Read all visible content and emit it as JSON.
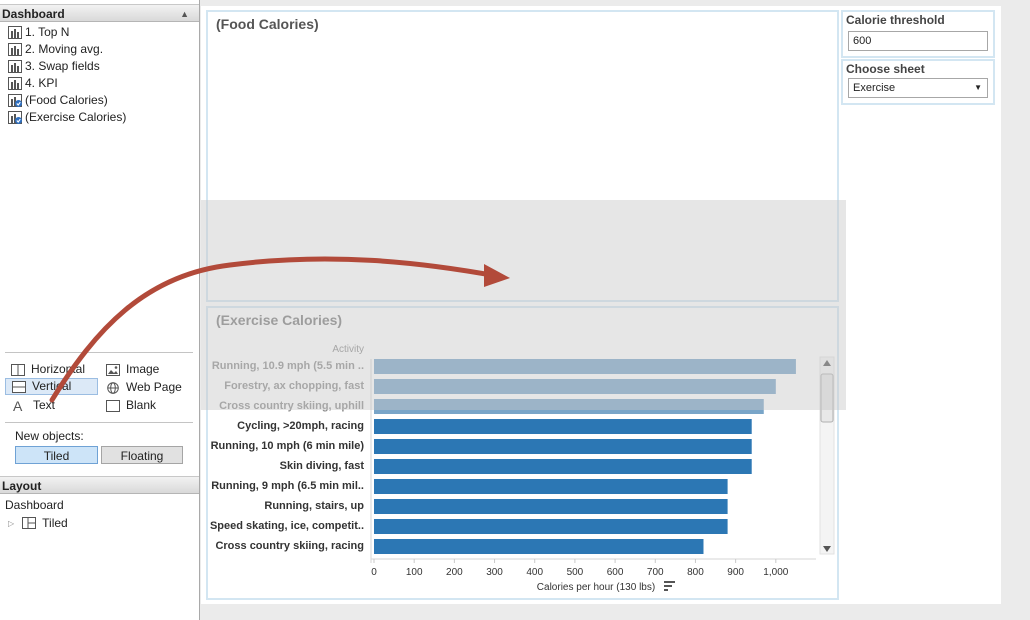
{
  "sidebar": {
    "dashboard_header": "Dashboard",
    "sheets": [
      {
        "label": "1. Top N",
        "icon": "bar-chart-icon"
      },
      {
        "label": "2. Moving avg.",
        "icon": "bar-chart-icon"
      },
      {
        "label": "3. Swap fields",
        "icon": "bar-chart-icon"
      },
      {
        "label": "4. KPI",
        "icon": "bar-chart-icon"
      },
      {
        "label": "(Food Calories)",
        "icon": "bar-chart-check-icon"
      },
      {
        "label": "(Exercise Calories)",
        "icon": "bar-chart-check-icon"
      }
    ],
    "objects": {
      "horizontal": "Horizontal",
      "vertical": "Vertical",
      "text": "Text",
      "image": "Image",
      "web_page": "Web Page",
      "blank": "Blank"
    },
    "new_objects_label": "New objects:",
    "tiled_label": "Tiled",
    "floating_label": "Floating",
    "layout_header": "Layout",
    "layout_dashboard": "Dashboard",
    "layout_tiled": "Tiled"
  },
  "dashboard": {
    "food_title": "(Food Calories)",
    "exercise_title": "(Exercise Calories)",
    "threshold_title": "Calorie threshold",
    "threshold_value": "600",
    "choose_title": "Choose sheet",
    "choose_value": "Exercise"
  },
  "colors": {
    "bar": "#2c77b4",
    "bar_faded": "#79a5c8",
    "zone_border": "#d3e6f2",
    "arrow": "#c0452f"
  },
  "chart_data": {
    "type": "bar",
    "orientation": "horizontal",
    "row_header": "Activity",
    "xlabel": "Calories per hour (130 lbs)",
    "xlim": [
      0,
      1100
    ],
    "ticks": [
      "0",
      "100",
      "200",
      "300",
      "400",
      "500",
      "600",
      "700",
      "800",
      "900",
      "1,000"
    ],
    "categories": [
      "Running, 10.9 mph (5.5 min ..",
      "Forestry, ax chopping, fast",
      "Cross country skiing, uphill",
      "Cycling, >20mph, racing",
      "Running, 10 mph (6 min mile)",
      "Skin diving, fast",
      "Running, 9 mph (6.5 min mil..",
      "Running, stairs, up",
      "Speed skating, ice, competit..",
      "Cross country skiing, racing"
    ],
    "values": [
      1050,
      1000,
      970,
      940,
      940,
      940,
      880,
      880,
      880,
      820
    ]
  }
}
